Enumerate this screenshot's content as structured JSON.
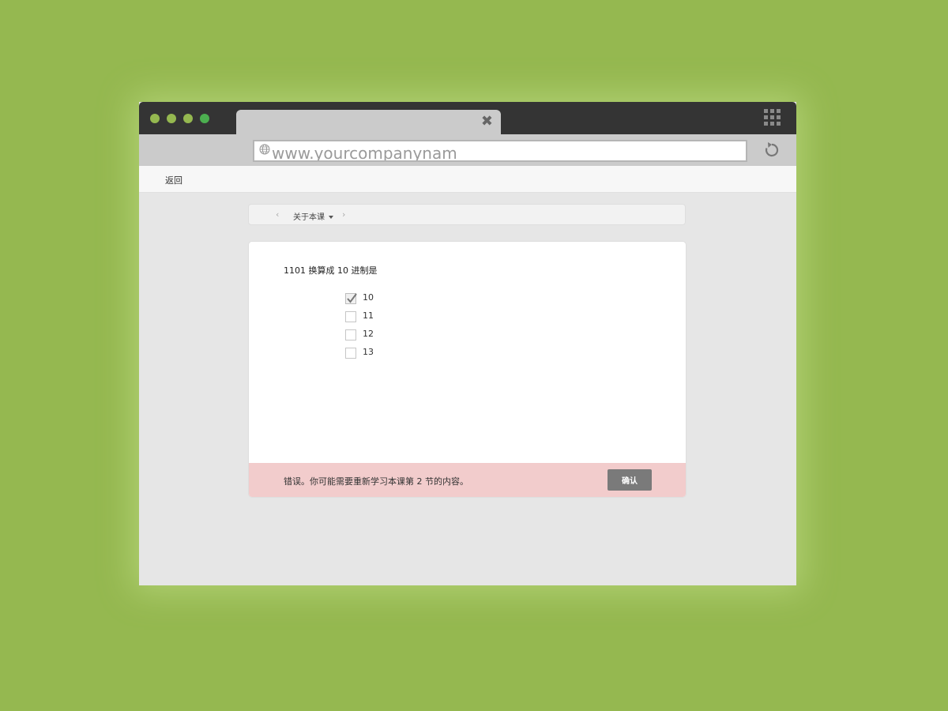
{
  "browser": {
    "window_dot_colors": [
      "#95b850",
      "#95b850",
      "#95b850",
      "#4caf50"
    ],
    "tab_close_icon": "close-icon",
    "url": "www.yourcompanynam",
    "apps_icon": "grid-icon",
    "reload_icon": "reload-icon"
  },
  "app": {
    "back_label": "返回"
  },
  "lesson_nav": {
    "prev_icon": "chevron-left-icon",
    "title": "关于本课",
    "next_icon": "chevron-right-icon"
  },
  "quiz": {
    "question": "1101 换算成 10 进制是",
    "options": [
      {
        "label": "10",
        "checked": true
      },
      {
        "label": "11",
        "checked": false
      },
      {
        "label": "12",
        "checked": false
      },
      {
        "label": "13",
        "checked": false
      }
    ]
  },
  "feedback": {
    "message": "错误。你可能需要重新学习本课第 2 节的内容。",
    "confirm_label": "确认",
    "background_color": "#f2cccc"
  }
}
